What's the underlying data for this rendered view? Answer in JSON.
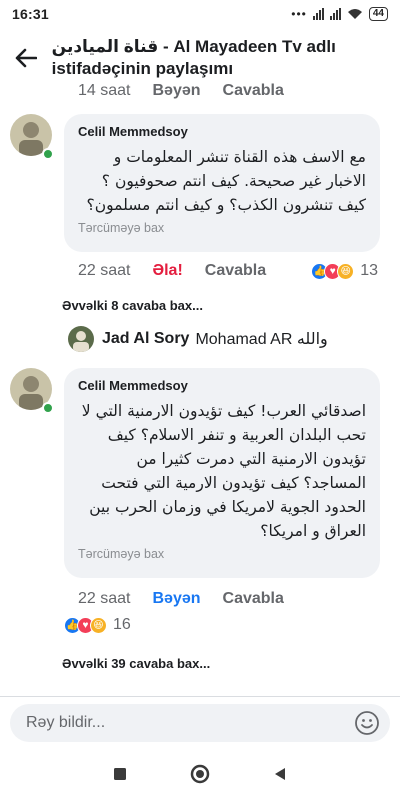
{
  "status_bar": {
    "time": "16:31",
    "battery": "44"
  },
  "header": {
    "title": "قناة الميادين - Al Mayadeen Tv adlı istifadəçinin paylaşımı"
  },
  "actions": {
    "time": "14 saat",
    "like": "Bəyən",
    "reply": "Cavabla"
  },
  "comments": [
    {
      "author": "Celil Memmedsoy",
      "text": "مع الاسف هذه القناة تنشر المعلومات و الاخبار غير صحيحة. كيف انتم صحوفيون ؟ كيف تنشرون الكذب؟ و كيف انتم مسلمون؟",
      "translate": "Tərcüməyə bax",
      "time": "22 saat",
      "reaction_label": "Əla!",
      "reply": "Cavabla",
      "reaction_count": "13"
    },
    {
      "author": "Celil Memmedsoy",
      "text": "اصدقائي العرب! كيف تؤيدون الارمنية التي لا تحب البلدان العربية و تنفر الاسلام؟ كيف تؤيدون الارمنية التي دمرت كثيرا من المساجد؟ كيف تؤيدون الارمية التي فتحت الحدود الجوية لامريكا في وزمان الحرب بين العراق و امريكا؟",
      "translate": "Tərcüməyə bax",
      "time": "22 saat",
      "like": "Bəyən",
      "reply": "Cavabla",
      "reaction_count": "16"
    }
  ],
  "previous_replies_1": "Əvvəlki 8 cavaba bax...",
  "reply_preview": {
    "author": "Jad Al Sory",
    "text": "Mohamad AR والله"
  },
  "previous_replies_2": "Əvvəlki 39 cavaba bax...",
  "composer": {
    "placeholder": "Rəy bildir..."
  },
  "colors": {
    "accent": "#1877f2",
    "love": "#e41e3f",
    "online": "#31a24c",
    "bubble": "#f0f2f5"
  },
  "icons": [
    "back-arrow-icon",
    "emoji-icon",
    "like-reaction-icon",
    "love-reaction-icon",
    "haha-reaction-icon",
    "nav-square-icon",
    "nav-circle-icon",
    "nav-back-icon"
  ]
}
